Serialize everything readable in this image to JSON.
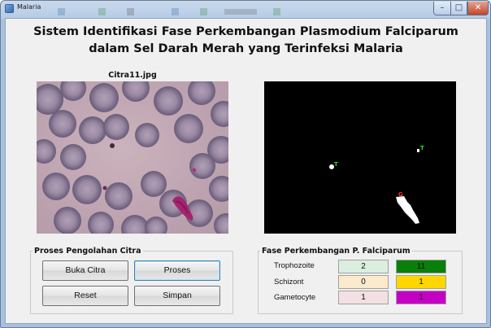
{
  "window": {
    "title": "Malaria"
  },
  "header": {
    "line1": "Sistem Identifikasi Fase Perkembangan Plasmodium Falciparum",
    "line2": "dalam Sel Darah Merah yang Terinfeksi Malaria"
  },
  "image_panel": {
    "filename": "Citra11.jpg"
  },
  "result_panel": {
    "markers": [
      {
        "text": "T",
        "color": "#22e022"
      },
      {
        "text": "T",
        "color": "#22e022"
      },
      {
        "text": "G",
        "color": "#ff3030"
      }
    ]
  },
  "processing": {
    "legend": "Proses Pengolahan Citra",
    "buttons": {
      "open": "Buka Citra",
      "process": "Proses",
      "reset": "Reset",
      "save": "Simpan"
    }
  },
  "phases": {
    "legend": "Fase Perkembangan P. Falciparum",
    "rows": [
      {
        "label": "Trophozoite",
        "count": "2",
        "total": "11",
        "count_bg": "#dbeee0",
        "total_bg": "#0a7f0a"
      },
      {
        "label": "Schizont",
        "count": "0",
        "total": "1",
        "count_bg": "#fbeacb",
        "total_bg": "#ffd600"
      },
      {
        "label": "Gametocyte",
        "count": "1",
        "total": "1",
        "count_bg": "#f2e0e3",
        "total_bg": "#c400c4"
      }
    ]
  }
}
